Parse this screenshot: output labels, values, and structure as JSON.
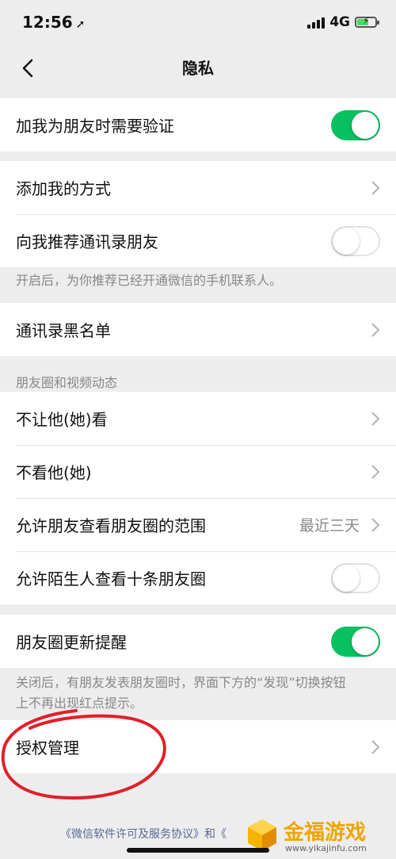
{
  "status_bar": {
    "time": "12:56",
    "network": "4G"
  },
  "nav": {
    "title": "隐私"
  },
  "rows": {
    "verify_friend": {
      "label": "加我为朋友时需要验证",
      "toggle": "on"
    },
    "add_me_ways": {
      "label": "添加我的方式"
    },
    "recommend_contacts": {
      "label": "向我推荐通讯录朋友",
      "toggle": "off"
    },
    "recommend_hint": "开启后，为你推荐已经开通微信的手机联系人。",
    "blacklist": {
      "label": "通讯录黑名单"
    },
    "moments_section_header": "朋友圈和视频动态",
    "dont_let_see": {
      "label": "不让他(她)看"
    },
    "dont_see": {
      "label": "不看他(她)"
    },
    "moments_range": {
      "label": "允许朋友查看朋友圈的范围",
      "value": "最近三天"
    },
    "stranger_view": {
      "label": "允许陌生人查看十条朋友圈",
      "toggle": "off"
    },
    "moments_update_reminder": {
      "label": "朋友圈更新提醒",
      "toggle": "on"
    },
    "reminder_hint_line1": "关闭后，有朋友发表朋友圈时，界面下方的“发现”切换按钮",
    "reminder_hint_line2": "上不再出现红点提示。",
    "authorization": {
      "label": "授权管理"
    }
  },
  "footer": {
    "link_text": "《微信软件许可及服务协议》和《"
  },
  "watermark": {
    "title": "金福游戏",
    "url": "www.yikajinfu.com"
  },
  "colors": {
    "accent_green": "#07c160",
    "background": "#ededed",
    "annotation_red": "#e0202a"
  }
}
